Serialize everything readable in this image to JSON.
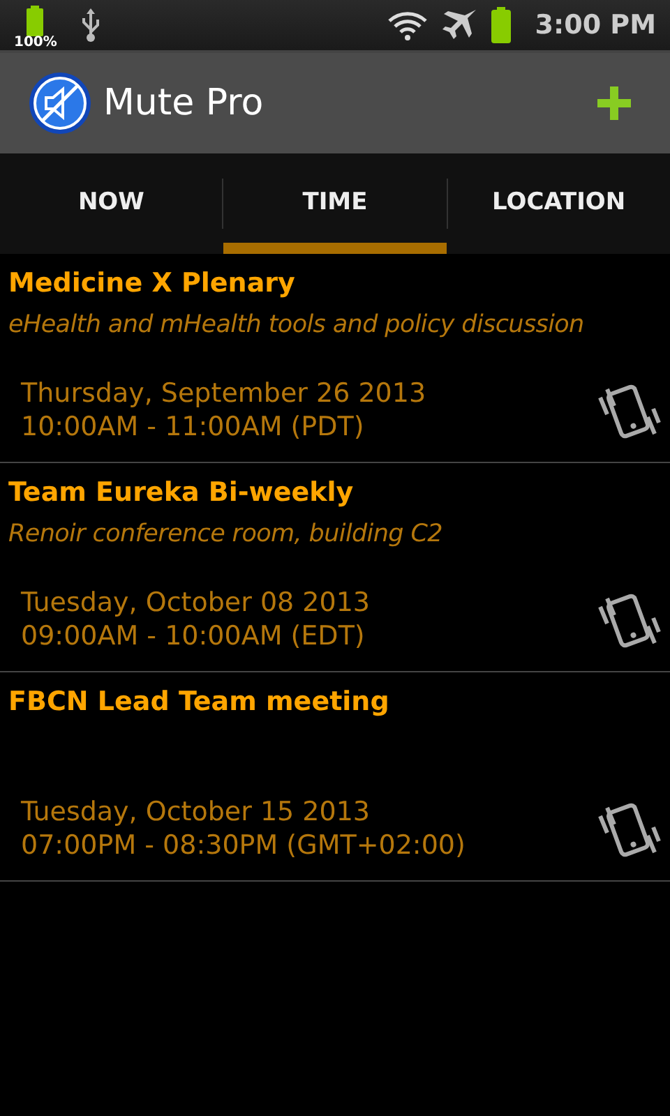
{
  "status_bar": {
    "battery_percent": "100%",
    "time": "3:00 PM"
  },
  "app_bar": {
    "title": "Mute Pro"
  },
  "tabs": [
    {
      "label": "NOW",
      "selected": false
    },
    {
      "label": "TIME",
      "selected": true
    },
    {
      "label": "LOCATION",
      "selected": false
    }
  ],
  "events": [
    {
      "title": "Medicine X Plenary",
      "subtitle": "eHealth and mHealth tools and policy discussion",
      "date": "Thursday, September 26 2013",
      "time": "10:00AM - 11:00AM (PDT)",
      "kind": "vibrate"
    },
    {
      "title": "Team Eureka Bi-weekly",
      "subtitle": "Renoir conference room, building C2",
      "date": "Tuesday, October 08 2013",
      "time": "09:00AM - 10:00AM (EDT)",
      "kind": "vibrate"
    },
    {
      "title": "FBCN Lead Team meeting",
      "date": "Tuesday, October 15 2013",
      "time": "07:00PM - 08:30PM (GMT+02:00)",
      "kind": "vibrate"
    }
  ]
}
